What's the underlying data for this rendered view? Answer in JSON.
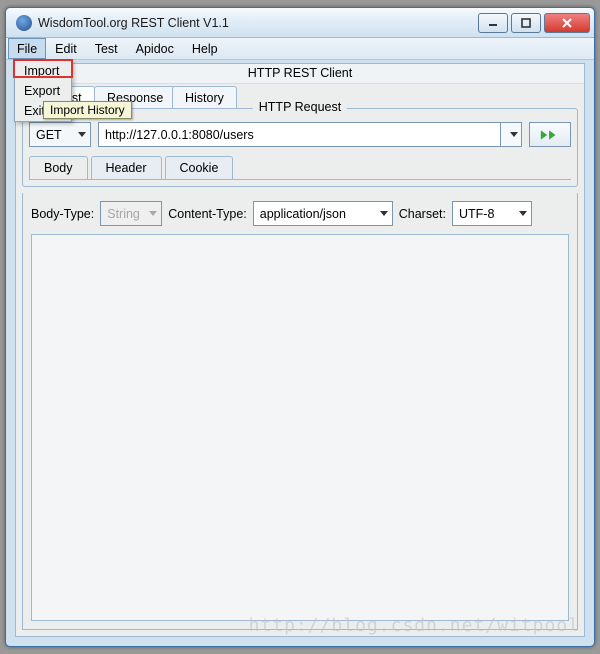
{
  "window": {
    "title": "WisdomTool.org REST Client V1.1"
  },
  "menubar": {
    "items": [
      "File",
      "Edit",
      "Test",
      "Apidoc",
      "Help"
    ],
    "active_index": 0
  },
  "file_menu": {
    "items": [
      "Import",
      "Export",
      "Exit"
    ],
    "highlighted_index": 0,
    "tooltip": "Import History"
  },
  "client": {
    "title": "HTTP REST Client",
    "main_tabs": [
      "Request",
      "Response",
      "History"
    ],
    "main_tabs_selected": 0,
    "request_box_title": "HTTP Request",
    "method": {
      "value": "GET"
    },
    "url": {
      "value": "http://127.0.0.1:8080/users"
    },
    "sub_tabs": [
      "Body",
      "Header",
      "Cookie"
    ],
    "sub_tabs_selected": 0,
    "body": {
      "body_type_label": "Body-Type:",
      "body_type_value": "String",
      "content_type_label": "Content-Type:",
      "content_type_value": "application/json",
      "charset_label": "Charset:",
      "charset_value": "UTF-8"
    }
  },
  "watermark": "http://blog.csdn.net/witpool"
}
